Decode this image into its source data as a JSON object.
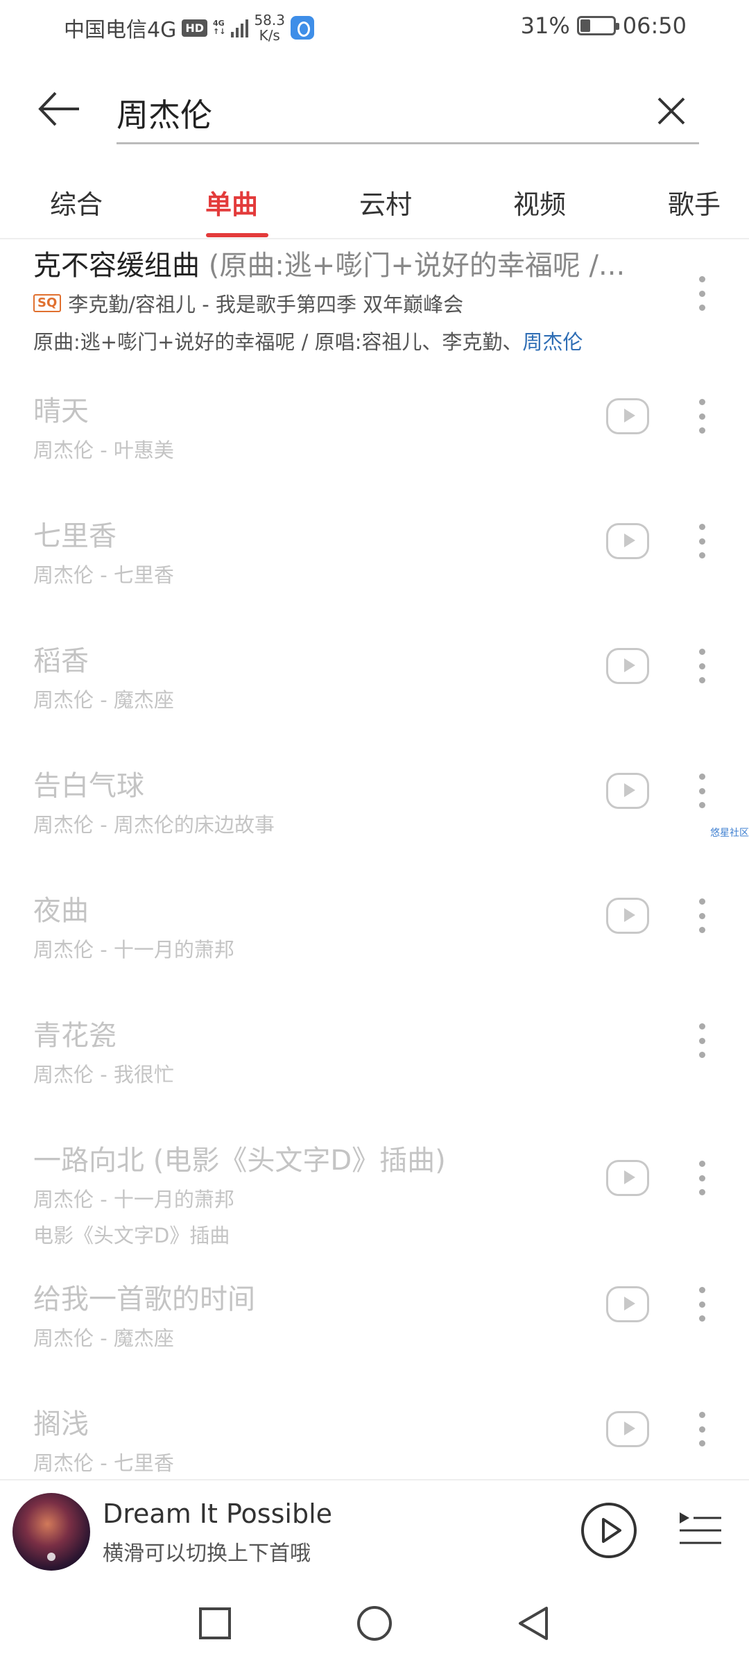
{
  "status_bar": {
    "carrier": "中国电信4G",
    "hd": "HD",
    "signal_top": "4G",
    "signal_bottom": "↑↓",
    "speed_value": "58.3",
    "speed_unit": "K/s",
    "battery_percent": "31%",
    "battery_level": 0.31,
    "time": "06:50"
  },
  "search": {
    "query": "周杰伦"
  },
  "tabs": [
    {
      "label": "综合",
      "active": false
    },
    {
      "label": "单曲",
      "active": true
    },
    {
      "label": "云村",
      "active": false
    },
    {
      "label": "视频",
      "active": false
    },
    {
      "label": "歌手",
      "active": false
    }
  ],
  "first_result": {
    "title": "克不容缓组曲",
    "title_suffix": "(原曲:逃+嘭门+说好的幸福呢 /...",
    "quality_badge": "SQ",
    "meta": "李克勤/容祖儿 - 我是歌手第四季 双年巅峰会",
    "origin_prefix": "原曲:逃+嘭门+说好的幸福呢 / 原唱:容祖儿、李克勤、",
    "origin_highlight": "周杰伦"
  },
  "songs": [
    {
      "title": "晴天",
      "subtitle": "周杰伦 - 叶惠美",
      "extra": "",
      "has_play": true
    },
    {
      "title": "七里香",
      "subtitle": "周杰伦 - 七里香",
      "extra": "",
      "has_play": true
    },
    {
      "title": "稻香",
      "subtitle": "周杰伦 - 魔杰座",
      "extra": "",
      "has_play": true
    },
    {
      "title": "告白气球",
      "subtitle": "周杰伦 - 周杰伦的床边故事",
      "extra": "",
      "has_play": true
    },
    {
      "title": "夜曲",
      "subtitle": "周杰伦 - 十一月的萧邦",
      "extra": "",
      "has_play": true
    },
    {
      "title": "青花瓷",
      "subtitle": "周杰伦 - 我很忙",
      "extra": "",
      "has_play": false
    },
    {
      "title": "一路向北 (电影《头文字D》插曲)",
      "subtitle": "周杰伦 - 十一月的萧邦",
      "extra": "电影《头文字D》插曲",
      "has_play": true
    },
    {
      "title": "给我一首歌的时间",
      "subtitle": "周杰伦 - 魔杰座",
      "extra": "",
      "has_play": true
    },
    {
      "title": "搁浅",
      "subtitle": "周杰伦 - 七里香",
      "extra": "",
      "has_play": true
    }
  ],
  "side_tag": "悠星社区",
  "player": {
    "title": "Dream It Possible",
    "subtitle": "横滑可以切换上下首哦"
  },
  "icons": {
    "back": "arrow-left-icon",
    "clear": "close-icon",
    "play": "play-circle-icon",
    "more": "more-vertical-icon",
    "playlist": "playlist-icon",
    "nav_recent": "square-icon",
    "nav_home": "circle-icon",
    "nav_back": "triangle-back-icon"
  },
  "colors": {
    "accent": "#e33b3b",
    "link": "#2f6eb5",
    "muted_text": "#c4c4c4"
  }
}
